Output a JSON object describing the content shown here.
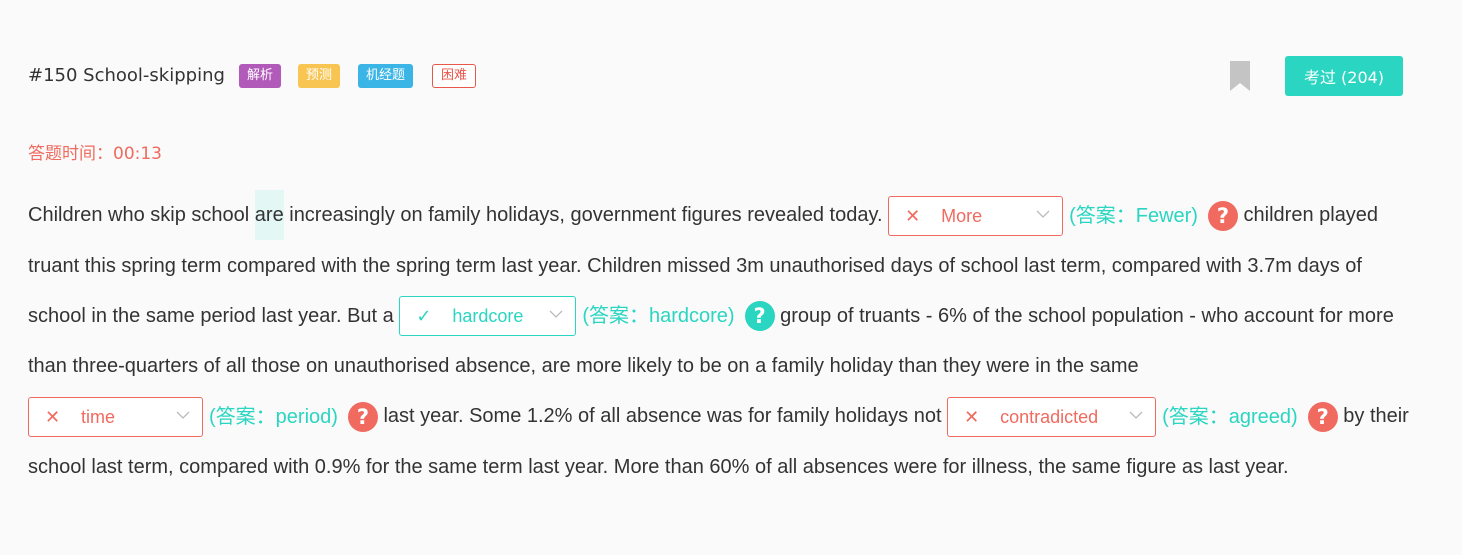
{
  "question": {
    "title": "#150 School-skipping",
    "tags": [
      "解析",
      "预测",
      "机经题",
      "困难"
    ],
    "tested_label": "考过 (204)"
  },
  "timer": "答题时间：00:13",
  "passage": {
    "t1a": "Children who skip school ",
    "t1hl": "are",
    "t1b": " increasingly on family holidays, government figures revealed today.",
    "t2": " children played truant this spring term compared with the spring term last year. Children missed 3m unauthorised days of school last term, compared with 3.7m days of school in the same period last year. But a ",
    "t3": " group of truants - 6% of the school population - who account for more than three-quarters of all those on unauthorised absence, are more likely to be on a family holiday than they were in the same ",
    "t4": " last year. Some 1.2% of all absence was for family holidays not ",
    "t5": " by their school last term, compared with 0.9% for the same term last year. More than 60% of all absences were for illness, the same figure as last year."
  },
  "blanks": [
    {
      "selected": "More",
      "status": "wrong",
      "answer": "(答案：Fewer)"
    },
    {
      "selected": "hardcore",
      "status": "correct",
      "answer": "(答案：hardcore)"
    },
    {
      "selected": "time",
      "status": "wrong",
      "answer": "(答案：period)"
    },
    {
      "selected": "contradicted",
      "status": "wrong",
      "answer": "(答案：agreed)"
    }
  ],
  "icons": {
    "wrong": "✕",
    "correct": "✓",
    "help": "?"
  },
  "colors": {
    "accent": "#2ad6c1",
    "error": "#f06a5f",
    "tag_analysis": "#b15ab9",
    "tag_predict": "#f9c552",
    "tag_machine": "#3ab5e6"
  }
}
